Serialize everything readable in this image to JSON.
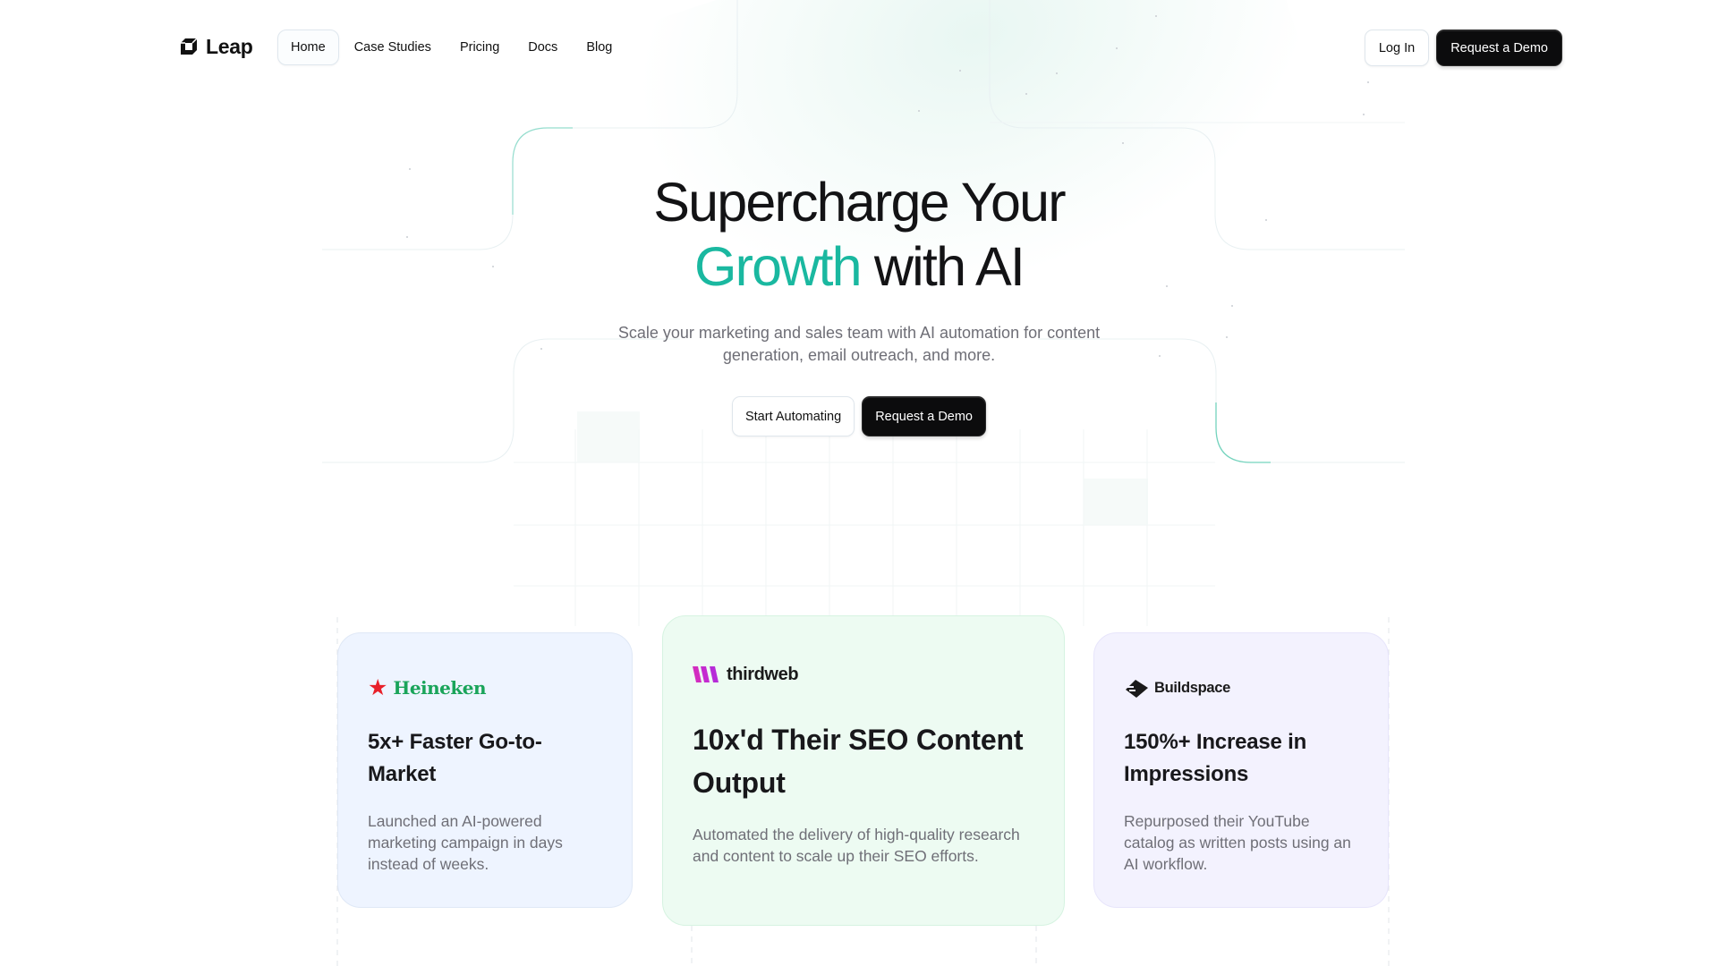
{
  "nav": {
    "brand": "Leap",
    "links": [
      {
        "label": "Home",
        "active": true
      },
      {
        "label": "Case Studies",
        "active": false
      },
      {
        "label": "Pricing",
        "active": false
      },
      {
        "label": "Docs",
        "active": false
      },
      {
        "label": "Blog",
        "active": false
      }
    ],
    "login_label": "Log In",
    "demo_label": "Request a Demo"
  },
  "hero": {
    "title_line1": "Supercharge Your",
    "title_accent": "Growth",
    "title_line2_rest": " with AI",
    "subtitle": "Scale your marketing and sales team with AI automation for content generation, email outreach, and more.",
    "primary_cta": "Start Automating",
    "secondary_cta": "Request a Demo"
  },
  "theme": {
    "accent": "#1ab8a0",
    "dark_button": "#0c0c0d"
  },
  "case_studies": [
    {
      "brand": "Heineken",
      "brand_icon": "star-icon",
      "title": "5x+ Faster Go-to-Market",
      "description": "Launched an AI-powered marketing campaign in days instead of weeks."
    },
    {
      "brand": "thirdweb",
      "brand_icon": "thirdweb-logo-icon",
      "title": "10x'd Their SEO Content Output",
      "description": "Automated the delivery of high-quality research and content to scale up their SEO efforts."
    },
    {
      "brand": "Buildspace",
      "brand_icon": "buildspace-logo-icon",
      "title": "150%+ Increase in Impressions",
      "description": "Repurposed their YouTube catalog as written posts using an AI workflow."
    }
  ]
}
